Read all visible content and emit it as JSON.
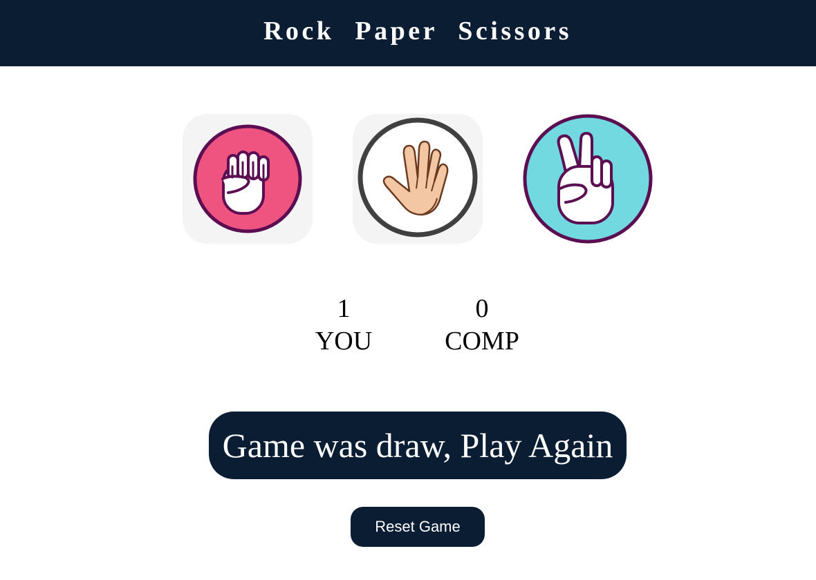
{
  "header": {
    "title": "Rock Paper Scissors"
  },
  "choices": [
    {
      "id": "rock",
      "icon": "rock-fist-icon",
      "color": "#ef5480"
    },
    {
      "id": "paper",
      "icon": "paper-hand-icon",
      "color": "#ffffff"
    },
    {
      "id": "scissors",
      "icon": "scissors-hand-icon",
      "color": "#72d9e1"
    }
  ],
  "scoreboard": {
    "user_score": "1",
    "user_label": "YOU",
    "comp_score": "0",
    "comp_label": "COMP"
  },
  "message": {
    "text": "Game was draw, Play Again",
    "background": "#0b1d33"
  },
  "reset": {
    "label": "Reset Game"
  },
  "colors": {
    "header_bg": "#0b1d33",
    "button_bg": "#0b1d33",
    "rock": "#ef5480",
    "scissors": "#72d9e1",
    "outline": "#5b0f52"
  }
}
